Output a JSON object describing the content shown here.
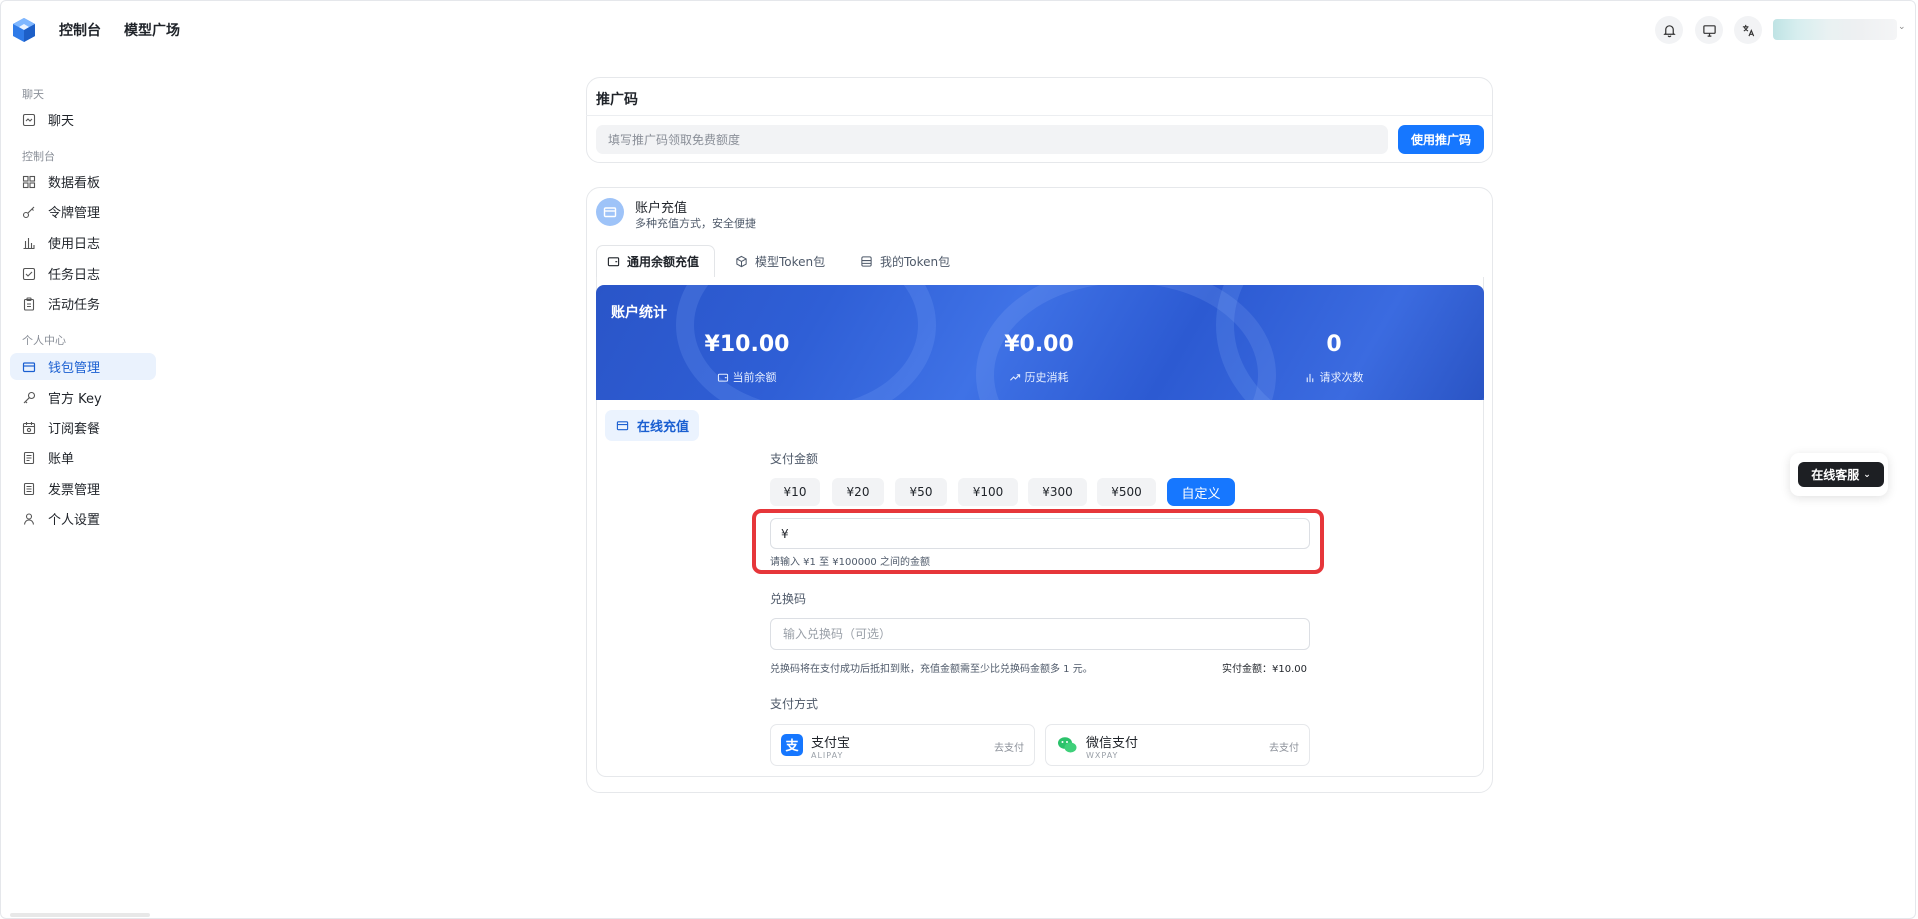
{
  "header": {
    "nav": [
      "控制台",
      "模型广场"
    ],
    "icons": [
      "bell-icon",
      "monitor-icon",
      "translate-icon"
    ]
  },
  "sidebar": {
    "sections": [
      {
        "title": "聊天",
        "items": [
          {
            "label": "聊天",
            "icon": "chat-icon"
          }
        ]
      },
      {
        "title": "控制台",
        "items": [
          {
            "label": "数据看板",
            "icon": "dashboard-icon"
          },
          {
            "label": "令牌管理",
            "icon": "key-icon"
          },
          {
            "label": "使用日志",
            "icon": "bar-chart-icon"
          },
          {
            "label": "任务日志",
            "icon": "checklist-icon"
          },
          {
            "label": "活动任务",
            "icon": "clipboard-icon"
          }
        ]
      },
      {
        "title": "个人中心",
        "items": [
          {
            "label": "钱包管理",
            "icon": "wallet-icon",
            "active": true
          },
          {
            "label": "官方 Key",
            "icon": "key-outline-icon"
          },
          {
            "label": "订阅套餐",
            "icon": "calendar-icon"
          },
          {
            "label": "账单",
            "icon": "receipt-icon"
          },
          {
            "label": "发票管理",
            "icon": "invoice-icon"
          },
          {
            "label": "个人设置",
            "icon": "user-icon"
          }
        ]
      }
    ]
  },
  "promo": {
    "title": "推广码",
    "placeholder": "填写推广码领取免费额度",
    "button": "使用推广码"
  },
  "recharge": {
    "title": "账户充值",
    "subtitle": "多种充值方式，安全便捷",
    "tabs": [
      {
        "label": "通用余额充值",
        "active": true
      },
      {
        "label": "模型Token包"
      },
      {
        "label": "我的Token包"
      }
    ],
    "stats": {
      "title": "账户统计",
      "items": [
        {
          "value": "¥10.00",
          "label": "当前余额"
        },
        {
          "value": "¥0.00",
          "label": "历史消耗"
        },
        {
          "value": "0",
          "label": "请求次数"
        }
      ]
    },
    "online_tab": "在线充值",
    "amount_label": "支付金额",
    "amounts": [
      "¥10",
      "¥20",
      "¥50",
      "¥100",
      "¥300",
      "¥500"
    ],
    "custom": "自定义",
    "amount_value": "¥",
    "amount_hint": "请输入 ¥1 至 ¥100000 之间的金额",
    "code_label": "兑换码",
    "code_placeholder": "输入兑换码（可选）",
    "code_hint": "兑换码将在支付成功后抵扣到账，充值金额需至少比兑换码金额多 1 元。",
    "pay_total": "实付金额：¥10.00",
    "pay_label": "支付方式",
    "methods": [
      {
        "name": "支付宝",
        "en": "ALIPAY",
        "action": "去支付",
        "color": "#1677ff"
      },
      {
        "name": "微信支付",
        "en": "WXPAY",
        "action": "去支付",
        "color": "#2bc26b"
      }
    ]
  },
  "service": {
    "label": "在线客服"
  }
}
